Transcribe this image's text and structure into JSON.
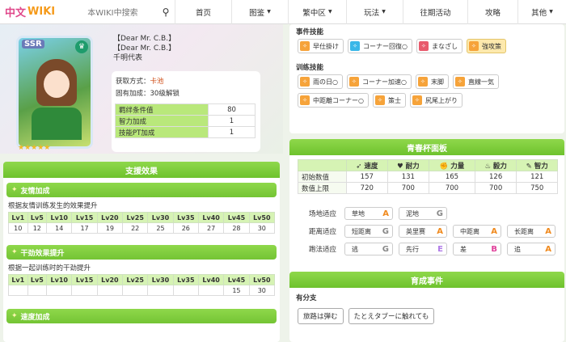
{
  "header": {
    "logo_text": "中文",
    "logo_wiki": "WIKI",
    "search_placeholder": "本WIKI中搜索",
    "nav": [
      {
        "label": "首页",
        "has_dropdown": false
      },
      {
        "label": "图鉴",
        "has_dropdown": true
      },
      {
        "label": "繁中区",
        "has_dropdown": true
      },
      {
        "label": "玩法",
        "has_dropdown": true
      },
      {
        "label": "往期活动",
        "has_dropdown": false
      },
      {
        "label": "攻略",
        "has_dropdown": false
      },
      {
        "label": "其他",
        "has_dropdown": true
      }
    ]
  },
  "card": {
    "rarity": "SSR",
    "stars": "★★★★★",
    "name_line1": "【Dear Mr. C.B.】",
    "name_line2": "【Dear Mr. C.B.】",
    "name_line3": "千明代表",
    "obtain_label": "获取方式：",
    "obtain_value": "卡池",
    "fixed_bonus_label": "固有加成：",
    "fixed_bonus_value": "30级解锁",
    "stats": [
      {
        "label": "羁绊条件值",
        "value": "80"
      },
      {
        "label": "智力加成",
        "value": "1"
      },
      {
        "label": "技能PT加成",
        "value": "1"
      }
    ]
  },
  "support_effects": {
    "title": "支援效果",
    "levels": [
      "Lv1",
      "Lv5",
      "Lv10",
      "Lv15",
      "Lv20",
      "Lv25",
      "Lv30",
      "Lv35",
      "Lv40",
      "Lv45",
      "Lv50"
    ],
    "friendship": {
      "title": "友情加成",
      "desc": "根据友情训练发生的效果提升",
      "values": [
        "10",
        "12",
        "14",
        "17",
        "19",
        "22",
        "25",
        "26",
        "27",
        "28",
        "30"
      ]
    },
    "motivation": {
      "title": "干劲效果提升",
      "desc": "根据一起训练时的干劲提升",
      "values": [
        "",
        "",
        "",
        "",
        "",
        "",
        "",
        "",
        "",
        "15",
        "30"
      ]
    },
    "speed": {
      "title": "速度加成"
    }
  },
  "event_skills": {
    "title": "事件技能",
    "items": [
      {
        "label": "早仕掛け",
        "icon": "orange-skill-icon",
        "gold": false
      },
      {
        "label": "コーナー回復○",
        "icon": "blue-skill-icon",
        "gold": false
      },
      {
        "label": "まなざし",
        "icon": "red-skill-icon",
        "gold": false
      },
      {
        "label": "強攻策",
        "icon": "orange-skill-icon",
        "gold": true
      }
    ]
  },
  "training_skills": {
    "title": "训练技能",
    "items": [
      {
        "label": "雨の日○",
        "gold": false
      },
      {
        "label": "コーナー加速○",
        "gold": false
      },
      {
        "label": "末脚",
        "gold": false
      },
      {
        "label": "直線一気",
        "gold": false
      },
      {
        "label": "中距離コーナー○",
        "gold": false
      },
      {
        "label": "策士",
        "gold": false
      },
      {
        "label": "尻尾上がり",
        "gold": false
      }
    ]
  },
  "youth_cup": {
    "title": "青春杯面板",
    "columns": [
      "速度",
      "耐力",
      "力量",
      "毅力",
      "智力"
    ],
    "rows": [
      {
        "label": "初始数值",
        "values": [
          "157",
          "131",
          "165",
          "126",
          "121"
        ]
      },
      {
        "label": "数值上限",
        "values": [
          "720",
          "700",
          "700",
          "700",
          "750"
        ]
      }
    ],
    "aptitudes": [
      {
        "label": "场地适应",
        "items": [
          {
            "name": "草地",
            "grade": "A"
          },
          {
            "name": "泥地",
            "grade": "G"
          }
        ]
      },
      {
        "label": "距离适应",
        "items": [
          {
            "name": "短距离",
            "grade": "G"
          },
          {
            "name": "英里赛",
            "grade": "A"
          },
          {
            "name": "中距离",
            "grade": "A"
          },
          {
            "name": "长距离",
            "grade": "A"
          }
        ]
      },
      {
        "label": "跑法适应",
        "items": [
          {
            "name": "逃",
            "grade": "G"
          },
          {
            "name": "先行",
            "grade": "E"
          },
          {
            "name": "差",
            "grade": "B"
          },
          {
            "name": "追",
            "grade": "A"
          }
        ]
      }
    ]
  },
  "training_events": {
    "title": "育成事件",
    "sub": "有分支",
    "events": [
      "旅路は弾む",
      "たとえタブーに触れても"
    ]
  }
}
